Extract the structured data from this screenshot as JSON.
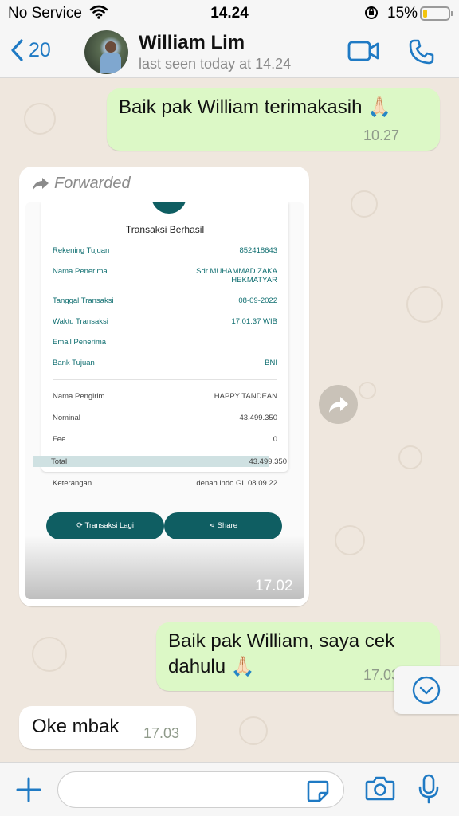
{
  "status_bar": {
    "carrier": "No Service",
    "time": "14.24",
    "battery_percent": "15%",
    "battery_level": 0.15
  },
  "header": {
    "back_count": "20",
    "contact_name": "William Lim",
    "last_seen": "last seen today at 14.24"
  },
  "messages": [
    {
      "direction": "outgoing",
      "text": "Baik pak William terimakasih 🙏🏻",
      "time": "10.27",
      "read": true
    },
    {
      "direction": "incoming",
      "forwarded_label": "Forwarded",
      "type": "image",
      "time": "17.02"
    },
    {
      "direction": "outgoing",
      "text": "Baik pak William, saya cek dahulu 🙏🏻",
      "time": "17.03"
    },
    {
      "direction": "incoming",
      "text": "Oke mbak",
      "time": "17.03"
    }
  ],
  "receipt": {
    "title": "Transaksi Berhasil",
    "rows": [
      {
        "label": "Rekening Tujuan",
        "value": "852418643"
      },
      {
        "label": "Nama Penerima",
        "value": "Sdr MUHAMMAD ZAKA HEKMATYAR"
      },
      {
        "label": "Tanggal Transaksi",
        "value": "08-09-2022"
      },
      {
        "label": "Waktu Transaksi",
        "value": "17:01:37 WIB"
      },
      {
        "label": "Email Penerima",
        "value": ""
      },
      {
        "label": "Bank Tujuan",
        "value": "BNI"
      },
      {
        "label": "Nama Pengirim",
        "value": "HAPPY TANDEAN"
      },
      {
        "label": "Nominal",
        "value": "43.499.350"
      },
      {
        "label": "Fee",
        "value": "0"
      },
      {
        "label": "Total",
        "value": "43.499.350"
      },
      {
        "label": "Keterangan",
        "value": "denah indo GL 08 09 22"
      }
    ],
    "buttons": {
      "repeat": "Transaksi Lagi",
      "share": "Share"
    }
  },
  "colors": {
    "outgoing_bubble": "#dcf8c6",
    "incoming_bubble": "#ffffff",
    "accent": "#1f7ac4",
    "receipt_teal": "#0f5e62"
  },
  "icons": {
    "back": "chevron-left-icon",
    "video": "video-camera-icon",
    "call": "phone-icon",
    "forward": "forward-arrow-icon",
    "read_ticks": "double-check-icon",
    "scroll_down": "chevron-down-icon",
    "plus": "plus-icon",
    "sticker": "sticker-icon",
    "camera": "camera-icon",
    "mic": "microphone-icon"
  },
  "composer": {
    "placeholder": ""
  }
}
